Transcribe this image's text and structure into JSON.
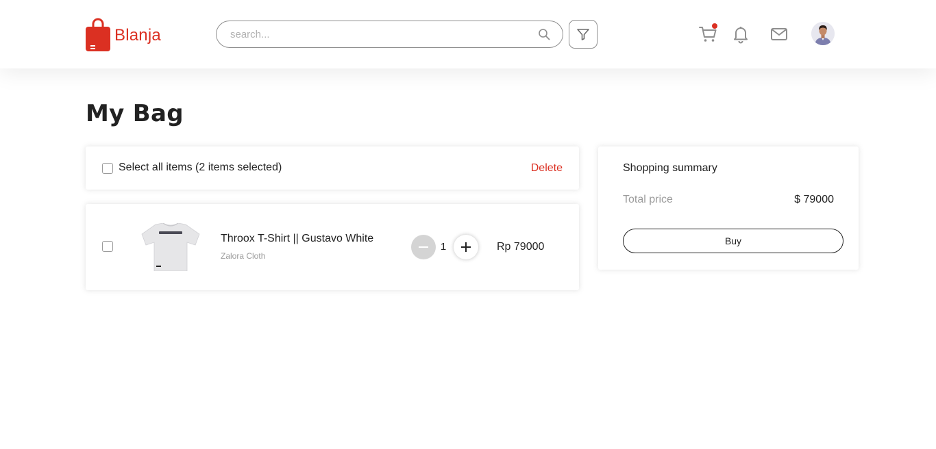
{
  "header": {
    "brand": "Blanja",
    "logo_icon": "shopping-bag-icon",
    "search": {
      "placeholder": "search...",
      "value": "",
      "icon": "search-icon"
    },
    "filter_icon": "filter-icon",
    "icons": [
      "cart-icon",
      "bell-icon",
      "mail-icon"
    ],
    "cart_has_notification": true,
    "avatar": "user-avatar"
  },
  "page": {
    "title": "My Bag"
  },
  "bag": {
    "select_all_label": "Select all items (2 items selected)",
    "delete_label": "Delete",
    "items": [
      {
        "name": "Throox T-Shirt || Gustavo White",
        "store": "Zalora Cloth",
        "quantity": "1",
        "price": "Rp 79000",
        "image": "t-shirt-image",
        "checked": false
      }
    ]
  },
  "summary": {
    "title": "Shopping summary",
    "total_label": "Total price",
    "total_value": "$ 79000",
    "buy_label": "Buy"
  },
  "colors": {
    "brand": "#DB3022",
    "text": "#222222",
    "muted": "#9b9b9b",
    "minus_button": "#d4d4d4"
  }
}
